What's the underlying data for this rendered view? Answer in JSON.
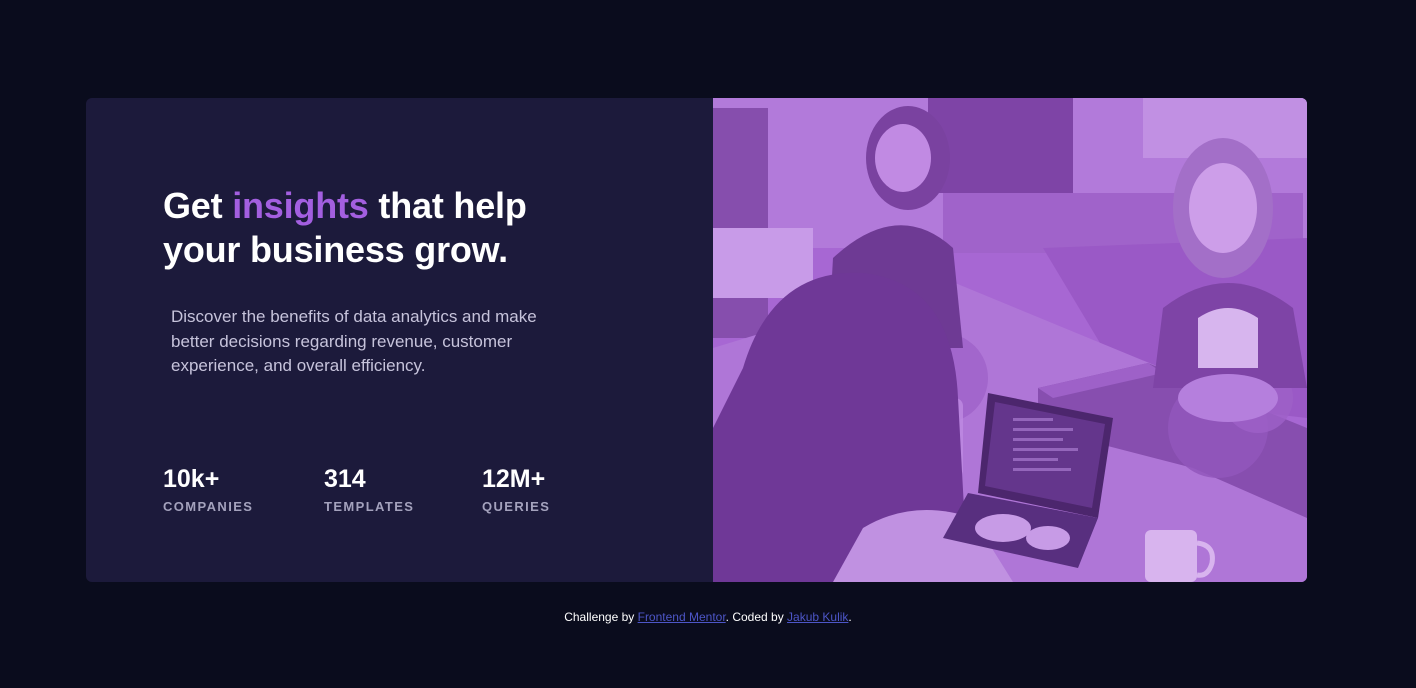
{
  "hero": {
    "headline_before": "Get ",
    "headline_accent": "insights",
    "headline_after": " that help your business grow.",
    "description": "Discover the benefits of data analytics and make better decisions regarding revenue, customer experience, and overall efficiency."
  },
  "stats": [
    {
      "value": "10k+",
      "label": "COMPANIES"
    },
    {
      "value": "314",
      "label": "TEMPLATES"
    },
    {
      "value": "12M+",
      "label": "QUERIES"
    }
  ],
  "image": {
    "alt": "three women working in an office"
  },
  "footer": {
    "prefix": "Challenge by ",
    "link1": "Frontend Mentor",
    "middle": ". Coded by ",
    "link2": "Jakub Kulik",
    "suffix": "."
  },
  "colors": {
    "background": "#0a0c1d",
    "card": "#1c1a3b",
    "accent": "#a35fe0",
    "image_tint": "#aa5cdb",
    "link": "#4d56c8"
  }
}
